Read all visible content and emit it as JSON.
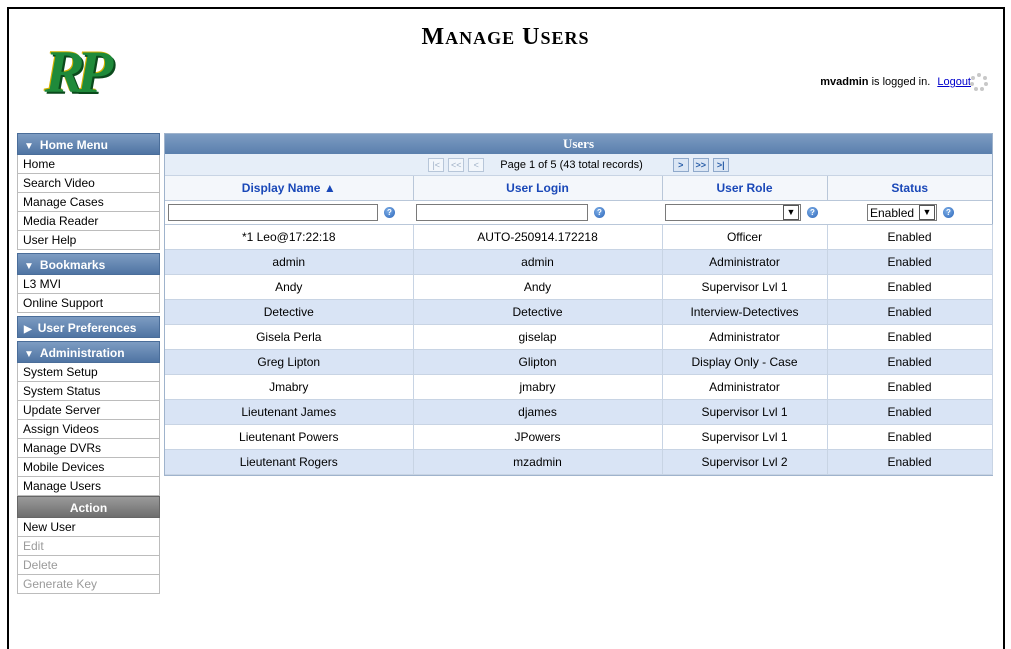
{
  "header": {
    "title_cap1": "M",
    "title_rest1": "ANAGE",
    "title_cap2": "U",
    "title_rest2": "SERS",
    "logo_text": "RP",
    "username": "mvadmin",
    "logged_in_text": "is logged in.",
    "logout_label": "Logout"
  },
  "sidebar": {
    "home_menu": {
      "title": "Home Menu",
      "items": [
        "Home",
        "Search Video",
        "Manage Cases",
        "Media Reader",
        "User Help"
      ]
    },
    "bookmarks": {
      "title": "Bookmarks",
      "items": [
        "L3 MVI",
        "Online Support"
      ]
    },
    "user_prefs": {
      "title": "User Preferences"
    },
    "administration": {
      "title": "Administration",
      "items": [
        "System Setup",
        "System Status",
        "Update Server",
        "Assign Videos",
        "Manage DVRs",
        "Mobile Devices",
        "Manage Users"
      ]
    },
    "action": {
      "title": "Action",
      "items": [
        "New User",
        "Edit",
        "Delete",
        "Generate Key"
      ]
    }
  },
  "users_panel": {
    "title": "Users",
    "pager_text": "Page 1 of 5 (43 total records)",
    "columns": [
      "Display Name ▲",
      "User Login",
      "User Role",
      "Status"
    ],
    "filter": {
      "display_name": "",
      "user_login": "",
      "user_role": "",
      "status": "Enabled"
    },
    "rows": [
      [
        "*1 Leo@17:22:18",
        "AUTO-250914.172218",
        "Officer",
        "Enabled"
      ],
      [
        "admin",
        "admin",
        "Administrator",
        "Enabled"
      ],
      [
        "Andy",
        "Andy",
        "Supervisor Lvl 1",
        "Enabled"
      ],
      [
        "Detective",
        "Detective",
        "Interview-Detectives",
        "Enabled"
      ],
      [
        "Gisela Perla",
        "giselap",
        "Administrator",
        "Enabled"
      ],
      [
        "Greg Lipton",
        "Glipton",
        "Display Only - Case",
        "Enabled"
      ],
      [
        "Jmabry",
        "jmabry",
        "Administrator",
        "Enabled"
      ],
      [
        "Lieutenant James",
        "djames",
        "Supervisor Lvl 1",
        "Enabled"
      ],
      [
        "Lieutenant Powers",
        "JPowers",
        "Supervisor Lvl 1",
        "Enabled"
      ],
      [
        "Lieutenant Rogers",
        "mzadmin",
        "Supervisor Lvl 2",
        "Enabled"
      ]
    ]
  }
}
